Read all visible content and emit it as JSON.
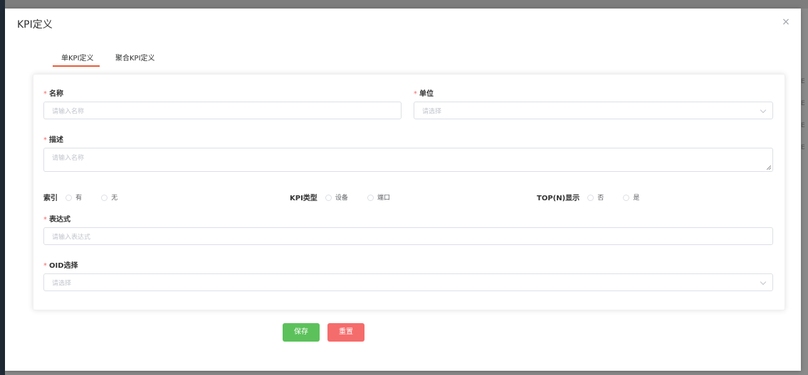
{
  "dialog": {
    "title": "KPI定义",
    "close_symbol": "×"
  },
  "tabs": [
    {
      "label": "单KPI定义",
      "active": true
    },
    {
      "label": "聚合KPI定义",
      "active": false
    }
  ],
  "form": {
    "required_mark": "*",
    "name": {
      "label": "名称",
      "placeholder": "请输入名称"
    },
    "unit": {
      "label": "单位",
      "placeholder": "请选择"
    },
    "description": {
      "label": "描述",
      "placeholder": "请输入名称"
    },
    "index": {
      "label": "索引",
      "options": [
        "有",
        "无"
      ]
    },
    "kpi_type": {
      "label": "KPI类型",
      "options": [
        "设备",
        "端口"
      ]
    },
    "top_n": {
      "label": "TOP(N)显示",
      "options": [
        "否",
        "是"
      ]
    },
    "expression": {
      "label": "表达式",
      "placeholder": "请输入表达式"
    },
    "oid": {
      "label": "OID选择",
      "placeholder": "请选择"
    }
  },
  "buttons": {
    "save": "保存",
    "reset": "重置"
  },
  "background_letters": [
    "E",
    "E",
    "E",
    "E"
  ],
  "colors": {
    "accent": "#e65d3a",
    "save": "#5cc15b",
    "reset": "#f56c6c",
    "required": "#f56c6c"
  }
}
